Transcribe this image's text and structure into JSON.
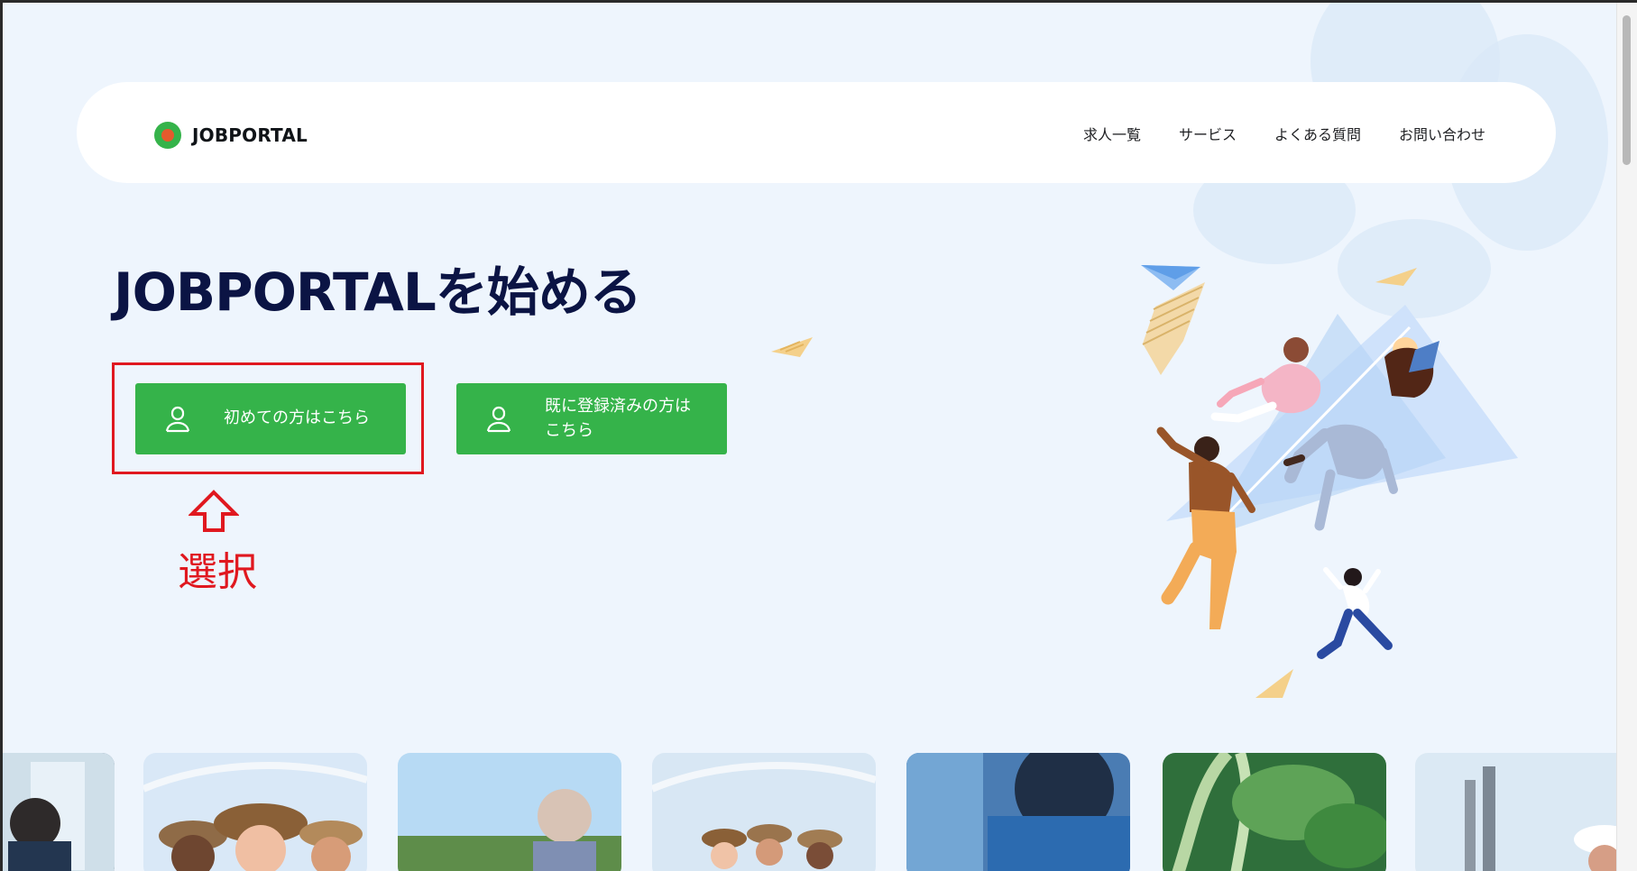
{
  "header": {
    "brand": "JOBPORTAL",
    "nav": [
      "求人一覧",
      "サービス",
      "よくある質問",
      "お問い合わせ"
    ]
  },
  "hero": {
    "title": "JOBPORTALを始める",
    "buttons": {
      "new_user": "初めての方はこちら",
      "registered_user": "既に登録済みの方はこちら"
    }
  },
  "annotation": {
    "label": "選択"
  },
  "colors": {
    "accent_green": "#35b34a",
    "annotation_red": "#e0181f",
    "title_navy": "#0b1444",
    "background": "#eef5fd"
  },
  "icons": {
    "button_icon": "user-icon",
    "annotation_icon": "arrow-up-icon"
  }
}
